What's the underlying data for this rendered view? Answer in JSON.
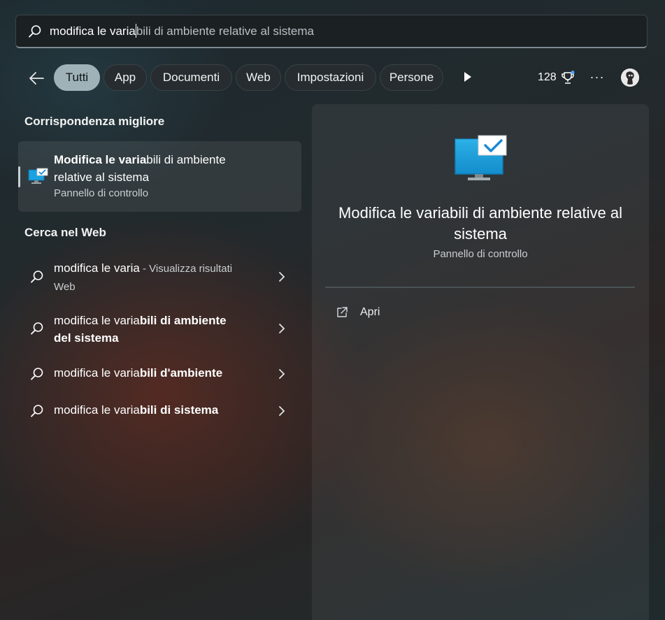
{
  "search": {
    "typed": "modifica le varia",
    "suggestion": "bili di ambiente relative al sistema"
  },
  "filters": {
    "tabs": [
      {
        "label": "Tutti",
        "active": true
      },
      {
        "label": "App",
        "active": false
      },
      {
        "label": "Documenti",
        "active": false
      },
      {
        "label": "Web",
        "active": false
      },
      {
        "label": "Impostazioni",
        "active": false
      },
      {
        "label": "Persone",
        "active": false
      }
    ],
    "points": "128",
    "more": "···"
  },
  "best_match": {
    "section_title": "Corrispondenza migliore",
    "title_bold": "Modifica le varia",
    "title_rest": "bili di ambiente relative al sistema",
    "subtitle": "Pannello di controllo",
    "icon": "monitor-check-icon"
  },
  "web": {
    "section_title": "Cerca nel Web",
    "items": [
      {
        "plain": "modifica le varia",
        "bold": "",
        "hint": " - Visualizza risultati",
        "line2": "Web"
      },
      {
        "plain": "modifica le varia",
        "bold": "bili di ambiente del sistema",
        "hint": "",
        "line2": ""
      },
      {
        "plain": "modifica le varia",
        "bold": "bili d'ambiente",
        "hint": "",
        "line2": ""
      },
      {
        "plain": "modifica le varia",
        "bold": "bili di sistema",
        "hint": "",
        "line2": ""
      }
    ]
  },
  "preview": {
    "title": "Modifica le variabili di ambiente relative al sistema",
    "subtitle": "Pannello di controllo",
    "actions": [
      {
        "label": "Apri",
        "icon": "open-external-icon"
      }
    ]
  },
  "colors": {
    "accent_pill": "#9fb2b8",
    "monitor_blue": "#1aa3e0",
    "reward_dot": "#4aa3ff"
  }
}
